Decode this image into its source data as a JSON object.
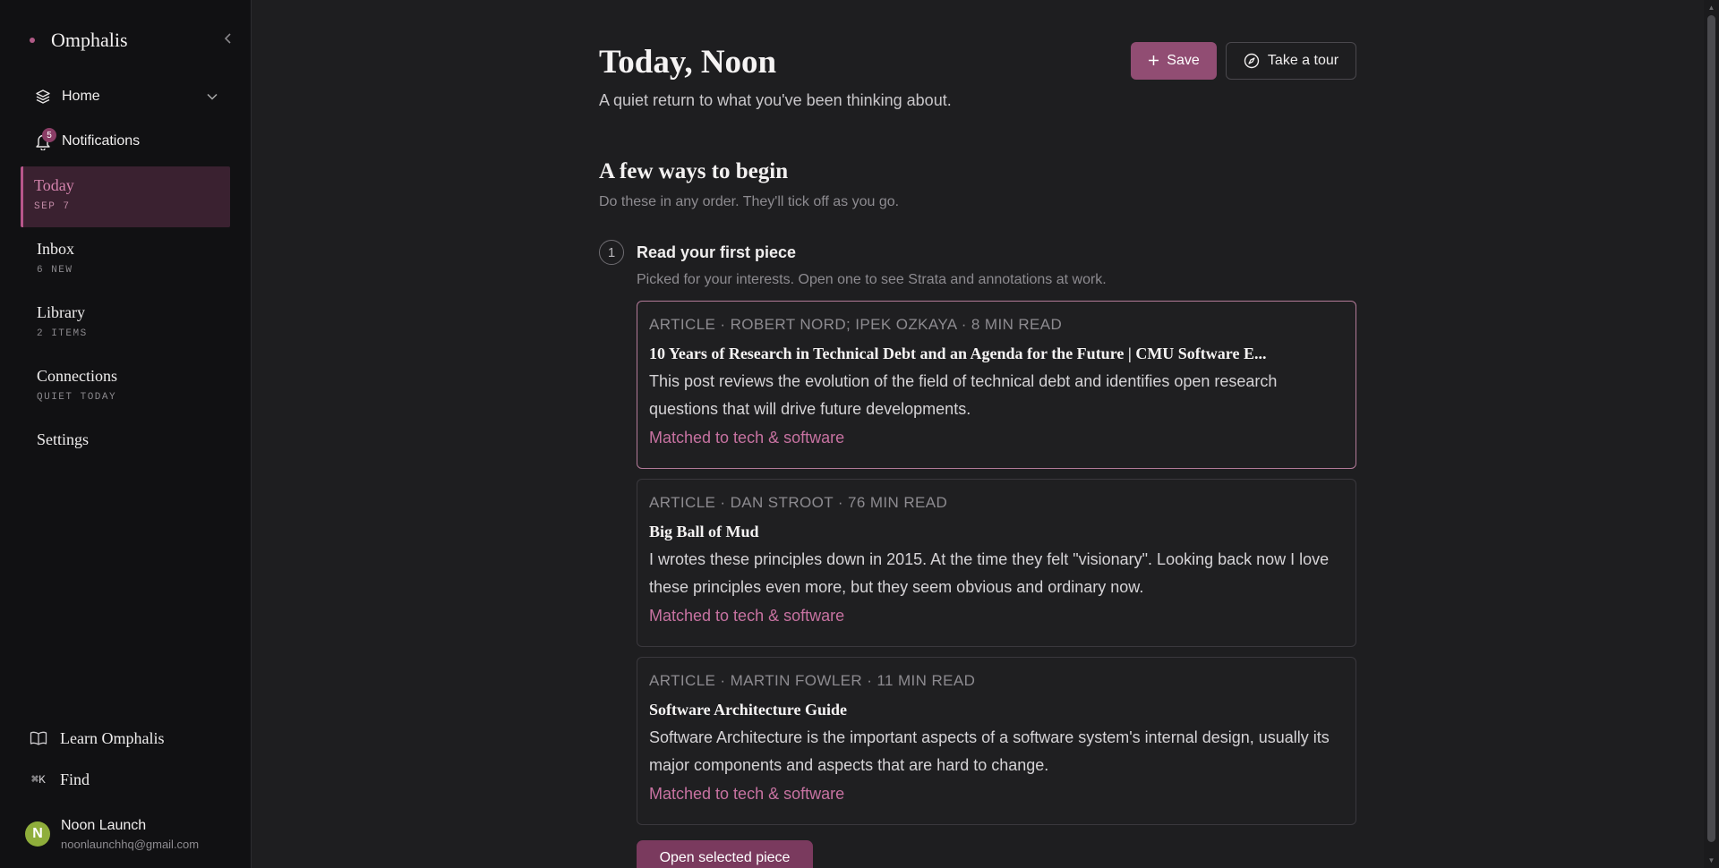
{
  "brand": {
    "name": "Omphalis"
  },
  "sidebar": {
    "top": [
      {
        "label": "Home"
      },
      {
        "label": "Notifications",
        "badge": "5"
      }
    ],
    "items": [
      {
        "title": "Today",
        "sub": "SEP 7"
      },
      {
        "title": "Inbox",
        "sub": "6 NEW"
      },
      {
        "title": "Library",
        "sub": "2 ITEMS"
      },
      {
        "title": "Connections",
        "sub": "QUIET TODAY"
      },
      {
        "title": "Settings",
        "sub": ""
      }
    ],
    "bottom": {
      "learn": "Learn Omphalis",
      "find": "Find",
      "find_shortcut": "⌘K"
    },
    "user": {
      "initial": "N",
      "name": "Noon Launch",
      "email": "noonlaunchhq@gmail.com"
    }
  },
  "header": {
    "title": "Today, Noon",
    "subtitle": "A quiet return to what you've been thinking about.",
    "save_label": "Save",
    "tour_label": "Take a tour"
  },
  "section": {
    "title": "A few ways to begin",
    "subtitle": "Do these in any order. They'll tick off as you go."
  },
  "step": {
    "number": "1",
    "title": "Read your first piece",
    "subtitle": "Picked for your interests. Open one to see Strata and annotations at work."
  },
  "cards": [
    {
      "meta": "ARTICLE · ROBERT NORD; IPEK OZKAYA · 8 MIN READ",
      "title": "10 Years of Research in Technical Debt and an Agenda for the Future | CMU Software E...",
      "desc": "This post reviews the evolution of the field of technical debt and identifies open research questions that will drive future developments.",
      "match": "Matched to tech & software"
    },
    {
      "meta": "ARTICLE · DAN STROOT · 76 MIN READ",
      "title": "Big Ball of Mud",
      "desc": "I wrotes these principles down in 2015. At the time they felt \"visionary\". Looking back now I love these principles even more, but they seem obvious and ordinary now.",
      "match": "Matched to tech & software"
    },
    {
      "meta": "ARTICLE · MARTIN FOWLER · 11 MIN READ",
      "title": "Software Architecture Guide",
      "desc": "Software Architecture is the important aspects of a software system's internal design, usually its major components and aspects that are hard to change.",
      "match": "Matched to tech & software"
    }
  ],
  "open_button": "Open selected piece",
  "colors": {
    "accent": "#914d73",
    "accent_text": "#c772a1",
    "sidebar_bg": "#111113",
    "main_bg": "#1e1e20",
    "avatar": "#8fae3b"
  }
}
